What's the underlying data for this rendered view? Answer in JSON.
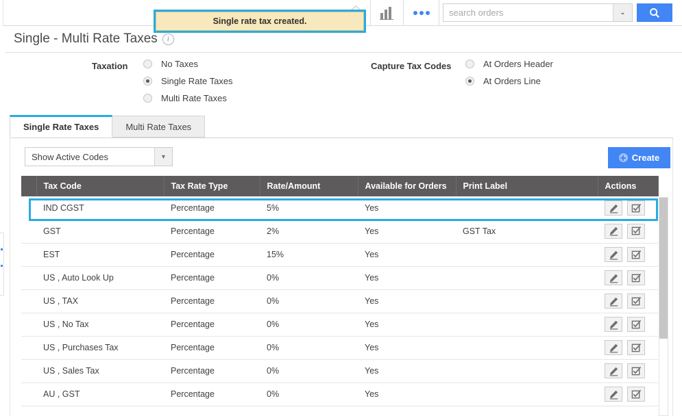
{
  "topbar": {
    "home_icon": "home-icon",
    "chart_icon": "bar-chart-icon",
    "more_icon": "more-dots-icon",
    "search": {
      "placeholder": "search orders",
      "value": "",
      "caret": "⌄",
      "search_icon": "magnifier-icon"
    }
  },
  "toast": {
    "message": "Single rate tax created.",
    "bg": "#f7e9bd",
    "highlight": "#29abe2"
  },
  "page": {
    "title": "Single - Multi Rate Taxes",
    "info_icon": "info-icon",
    "info_glyph": "i"
  },
  "taxation": {
    "label": "Taxation",
    "options": [
      {
        "label": "No Taxes",
        "checked": false
      },
      {
        "label": "Single Rate Taxes",
        "checked": true
      },
      {
        "label": "Multi Rate Taxes",
        "checked": false
      }
    ]
  },
  "capture_tax_codes": {
    "label": "Capture Tax Codes",
    "options": [
      {
        "label": "At Orders Header",
        "checked": false
      },
      {
        "label": "At Orders Line",
        "checked": true
      }
    ]
  },
  "tabs": [
    {
      "label": "Single Rate Taxes",
      "active": true
    },
    {
      "label": "Multi Rate Taxes",
      "active": false
    }
  ],
  "filter": {
    "selected": "Show Active Codes",
    "caret": "▼"
  },
  "create_button": {
    "label": "Create",
    "icon": "plus-circle-icon",
    "color": "#4285f4"
  },
  "table": {
    "columns": [
      "",
      "Tax Code",
      "Tax Rate Type",
      "Rate/Amount",
      "Available for Orders",
      "Print Label",
      "Actions"
    ],
    "header_bg": "#5d5b5b",
    "rows": [
      {
        "tax_code": "IND CGST",
        "tax_rate_type": "Percentage",
        "rate_amount": "5%",
        "available_for_orders": "Yes",
        "print_label": "",
        "highlighted": true
      },
      {
        "tax_code": "GST",
        "tax_rate_type": "Percentage",
        "rate_amount": "2%",
        "available_for_orders": "Yes",
        "print_label": "GST Tax",
        "highlighted": false
      },
      {
        "tax_code": "EST",
        "tax_rate_type": "Percentage",
        "rate_amount": "15%",
        "available_for_orders": "Yes",
        "print_label": "",
        "highlighted": false
      },
      {
        "tax_code": "US , Auto Look Up",
        "tax_rate_type": "Percentage",
        "rate_amount": "0%",
        "available_for_orders": "Yes",
        "print_label": "",
        "highlighted": false
      },
      {
        "tax_code": "US , TAX",
        "tax_rate_type": "Percentage",
        "rate_amount": "0%",
        "available_for_orders": "Yes",
        "print_label": "",
        "highlighted": false
      },
      {
        "tax_code": "US , No Tax",
        "tax_rate_type": "Percentage",
        "rate_amount": "0%",
        "available_for_orders": "Yes",
        "print_label": "",
        "highlighted": false
      },
      {
        "tax_code": "US , Purchases Tax",
        "tax_rate_type": "Percentage",
        "rate_amount": "0%",
        "available_for_orders": "Yes",
        "print_label": "",
        "highlighted": false
      },
      {
        "tax_code": "US , Sales Tax",
        "tax_rate_type": "Percentage",
        "rate_amount": "0%",
        "available_for_orders": "Yes",
        "print_label": "",
        "highlighted": false
      },
      {
        "tax_code": "AU , GST",
        "tax_rate_type": "Percentage",
        "rate_amount": "0%",
        "available_for_orders": "Yes",
        "print_label": "",
        "highlighted": false
      }
    ],
    "actions": {
      "edit_icon": "pencil-edit-icon",
      "select_icon": "checkbox-check-icon"
    }
  }
}
